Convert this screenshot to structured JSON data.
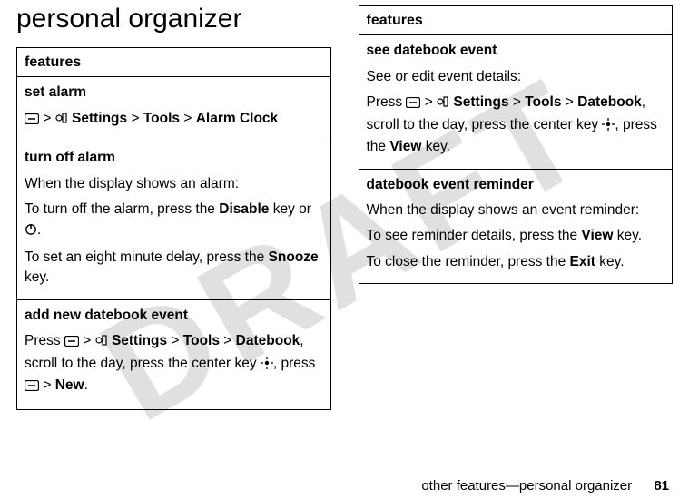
{
  "watermark": "DRAFT",
  "page_title": "personal organizer",
  "footer_text": "other features—personal organizer",
  "page_number": "81",
  "gt": ">",
  "nav": {
    "settings": "Settings",
    "tools": "Tools",
    "alarm_clock": "Alarm Clock",
    "datebook": "Datebook",
    "new": "New"
  },
  "keys": {
    "disable": "Disable",
    "snooze": "Snooze",
    "view": "View",
    "exit": "Exit"
  },
  "left": {
    "header": "features",
    "r1_title": "set alarm",
    "r2_title": "turn off alarm",
    "r2_p1": "When the display shows an alarm:",
    "r2_p2a": "To turn off the alarm, press the ",
    "r2_p2b": " key or ",
    "r2_p2c": ".",
    "r2_p3a": "To set an eight minute delay, press the ",
    "r2_p3b": " key.",
    "r3_title": "add new datebook event",
    "r3_p1a": "Press ",
    "r3_p1b": ", scroll to the day, press the center key ",
    "r3_p1c": ", press "
  },
  "right": {
    "header": "features",
    "r1_title": "see datebook event",
    "r1_p1": "See or edit event details:",
    "r1_p2a": "Press ",
    "r1_p2b": ", scroll to the day, press the center key ",
    "r1_p2c": ", press the ",
    "r1_p2d": " key.",
    "r2_title": "datebook event reminder",
    "r2_p1": "When the display shows an event reminder:",
    "r2_p2a": "To see reminder details, press the ",
    "r2_p2b": " key.",
    "r2_p3a": "To close the reminder, press the ",
    "r2_p3b": " key."
  }
}
